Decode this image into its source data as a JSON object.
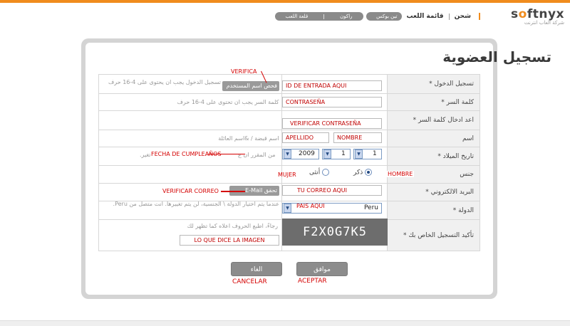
{
  "header": {
    "brand": "softnyx",
    "brand_pre": "s",
    "brand_dot": "o",
    "brand_post": "ftnyx",
    "brand_sub": "شركة العاب انترنت",
    "nav": [
      "شحن",
      "قائمة اللعب"
    ],
    "pill_short": "تين بوكس",
    "pill_long": [
      "راكون",
      "قلعة اللعب"
    ]
  },
  "page": {
    "title": "تسجيل العضوية"
  },
  "form": {
    "login_id": {
      "label": "تسجيل الدخول *",
      "value": "ID DE ENTRADA AQUI",
      "check_button": "فحص اسم المستخدم",
      "hint": "تسجيل الدخول يجب ان يحتوى على 4-16 حرف",
      "annotation": "VERIFICA"
    },
    "password": {
      "label": "كلمة السر *",
      "value": "CONTRASEÑA",
      "hint": "كلمة السر يجب ان تحتوى على 4-16 حرف"
    },
    "password_confirm": {
      "label": "اعد ادخال كلمة السر *",
      "value": "VERIFICAR CONTRASEÑA"
    },
    "name": {
      "label": "اسم",
      "first_value": "NOMBRE",
      "last_value": "APELLIDO",
      "hint": "اسم قبضة / &اسم العائلة"
    },
    "birthdate": {
      "label": "تاريخ الميلاد *",
      "day": "1",
      "month": "1",
      "year": "2009",
      "hint": "من المقرر ان ع",
      "hint2": "تغير.",
      "annotation": "FECHA DE CUMPLEAÑOS"
    },
    "gender": {
      "label": "جنس",
      "male": "ذكر",
      "female": "أنثى",
      "male_annotation": "HOMBRE",
      "female_annotation": "MUJER"
    },
    "email": {
      "label": "البريد الالكتروني *",
      "value": "TU CORREO AQUI",
      "check_button": "تحقق E-Mail",
      "annotation": "VERIFICAR CORREO"
    },
    "country": {
      "label": "الدولة *",
      "value": "Peru",
      "annotation": "PAIS AQUI",
      "hint": "عندما يتم اختيار الدولة \\ الجنسية، لن يتم تغييرها. انت متصل من Peru."
    },
    "captcha": {
      "label": "تأكيد التسجيل الخاص بك *",
      "code": "F2X0G7K5",
      "hint": "رجاءً، اطبع الحروف اعلاه كما تظهر لك",
      "input_annotation": "LO QUE DICE LA IMAGEN"
    }
  },
  "buttons": {
    "ok": "موافق",
    "cancel": "الغاء",
    "ok_annotation": "ACEPTAR",
    "cancel_annotation": "CANCELAR"
  }
}
